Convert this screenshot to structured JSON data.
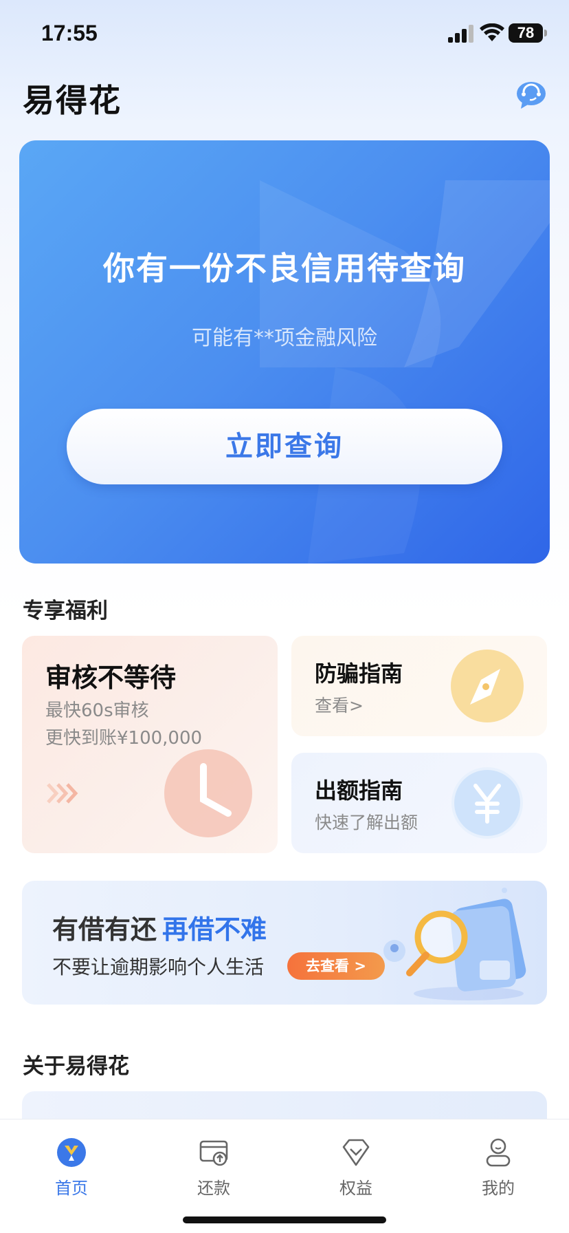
{
  "status_bar": {
    "time": "17:55",
    "battery": "78"
  },
  "header": {
    "title": "易得花"
  },
  "hero": {
    "title": "你有一份不良信用待查询",
    "subtitle": "可能有**项金融风险",
    "button_label": "立即查询"
  },
  "perks": {
    "section_title": "专享福利",
    "review": {
      "title": "审核不等待",
      "line1": "最快60s审核",
      "line2": "更快到账¥100,000"
    },
    "fraud_guide": {
      "title": "防骗指南",
      "subtitle": "查看>"
    },
    "limit_guide": {
      "title": "出额指南",
      "subtitle": "快速了解出额"
    }
  },
  "promo": {
    "title_plain": "有借有还",
    "title_highlight": "再借不难",
    "subtitle": "不要让逾期影响个人生活",
    "button_label": "去查看 >"
  },
  "about": {
    "section_title": "关于易得花"
  },
  "tabbar": {
    "items": [
      {
        "label": "首页",
        "icon": "home-logo-icon",
        "active": true
      },
      {
        "label": "还款",
        "icon": "repay-card-icon",
        "active": false
      },
      {
        "label": "权益",
        "icon": "diamond-icon",
        "active": false
      },
      {
        "label": "我的",
        "icon": "user-icon",
        "active": false
      }
    ]
  },
  "colors": {
    "accent": "#3b78e8",
    "promo_button": "#f5723c"
  }
}
